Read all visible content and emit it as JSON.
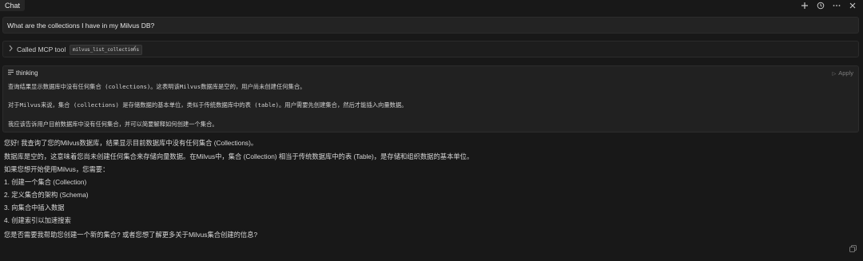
{
  "header": {
    "tab_label": "Chat",
    "icons": [
      "plus-icon",
      "history-icon",
      "more-icon",
      "close-icon"
    ]
  },
  "user_message": "What are the collections I have in my Milvus DB?",
  "mcp_call": {
    "label": "Called MCP tool",
    "tool_name": "milvus_list_collections"
  },
  "thinking": {
    "title": "thinking",
    "apply_label": "Apply",
    "lines": [
      "查询结果显示数据库中没有任何集合 (collections)。这表明该Milvus数据库是空的，用户尚未创建任何集合。",
      "对于Milvus来说，集合 (collections) 是存储数据的基本单位，类似于传统数据库中的表 (table)。用户需要先创建集合，然后才能插入向量数据。",
      "我应该告诉用户目前数据库中没有任何集合，并可以简要解释如何创建一个集合。"
    ]
  },
  "answer": {
    "lines": [
      "您好! 我查询了您的Milvus数据库，结果显示目前数据库中没有任何集合 (Collections)。",
      "数据库是空的，这意味着您尚未创建任何集合来存储向量数据。在Milvus中，集合 (Collection) 相当于传统数据库中的表 (Table)，是存储和组织数据的基本单位。",
      "如果您想开始使用Milvus，您需要：",
      "1. 创建一个集合 (Collection)",
      "2. 定义集合的架构 (Schema)",
      "3. 向集合中插入数据",
      "4. 创建索引以加速搜索",
      "您是否需要我帮助您创建一个新的集合? 或者您想了解更多关于Milvus集合创建的信息?"
    ]
  }
}
